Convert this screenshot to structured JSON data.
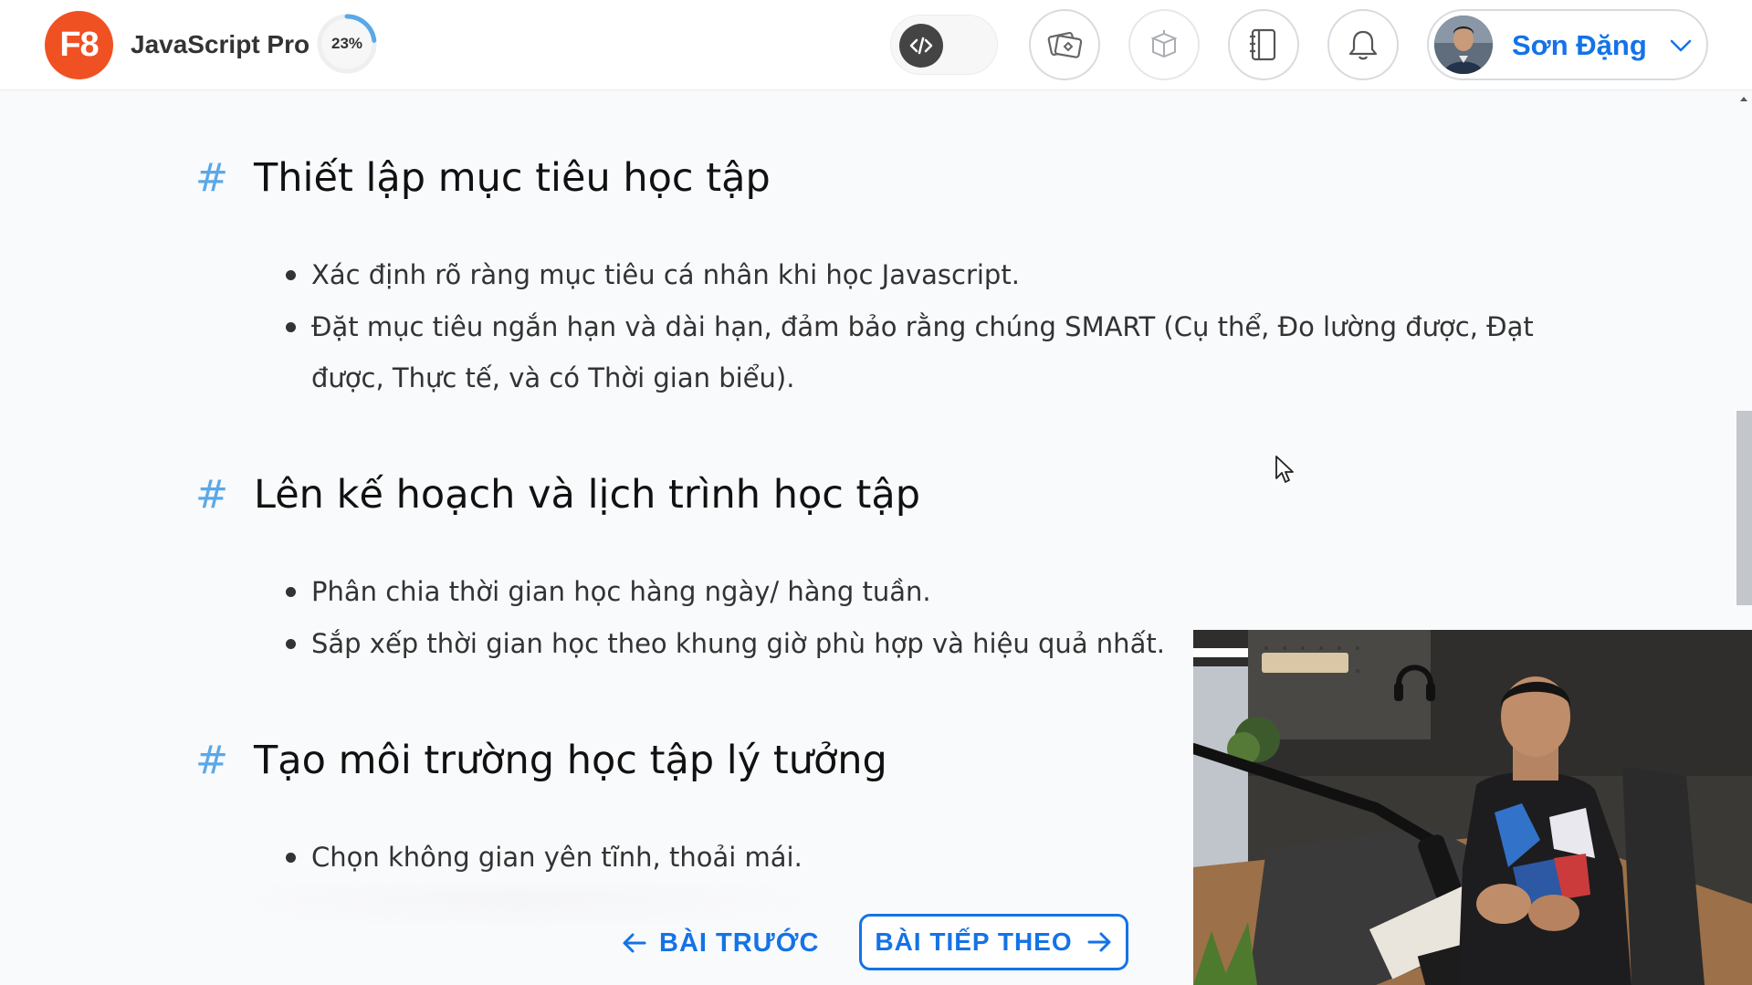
{
  "header": {
    "logo_text": "F8",
    "course_title": "JavaScript Pro",
    "progress_label": "23%",
    "progress_value": 0.23,
    "user_name": "Sơn Đặng",
    "icons": [
      "code-toggle-icon",
      "flashcard-icon",
      "gift-box-icon",
      "notebook-icon",
      "bell-icon",
      "chevron-down-icon"
    ]
  },
  "sections": [
    {
      "hash": "#",
      "title": "Thiết lập mục tiêu học tập",
      "items": [
        "Xác định rõ ràng mục tiêu cá nhân khi học Javascript.",
        "Đặt mục tiêu ngắn hạn và dài hạn, đảm bảo rằng chúng SMART (Cụ thể, Đo lường được, Đạt",
        "được, Thực tế, và có Thời gian biểu)."
      ]
    },
    {
      "hash": "#",
      "title": "Lên kế hoạch và lịch trình học tập",
      "items": [
        "Phân chia thời gian học hàng ngày/ hàng tuần.",
        "Sắp xếp thời gian học theo khung giờ phù hợp và hiệu quả nhất."
      ]
    },
    {
      "hash": "#",
      "title": "Tạo môi trường học tập lý tưởng",
      "items": [
        "Chọn không gian yên tĩnh, thoải mái."
      ]
    }
  ],
  "nav": {
    "prev_label": "BÀI TRƯỚC",
    "next_label": "BÀI TIẾP THEO"
  },
  "colors": {
    "brand": "#f05123",
    "accent": "#1473e6",
    "hash": "#5aa8e8"
  }
}
